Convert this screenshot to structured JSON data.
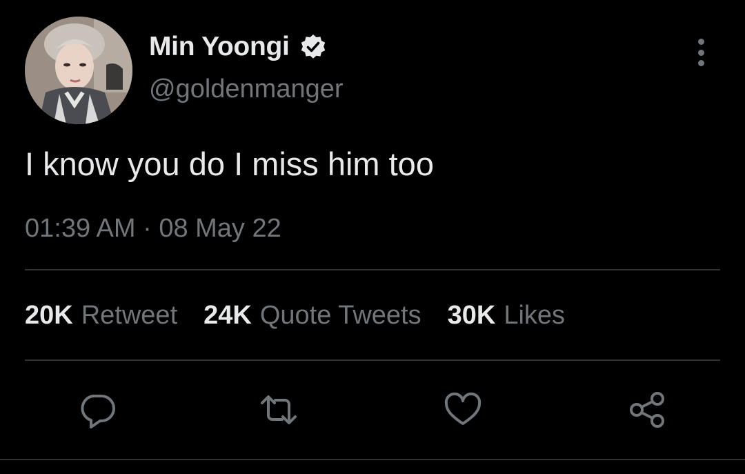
{
  "author": {
    "display_name": "Min Yoongi",
    "handle": "@goldenmanger",
    "verified": true,
    "verified_badge_icon": "verified-check-icon",
    "avatar_icon": "profile-photo"
  },
  "menu": {
    "more_icon": "more-vertical-icon"
  },
  "tweet": {
    "text": "I know you do I miss him too",
    "timestamp": "01:39 AM · 08 May 22"
  },
  "stats": [
    {
      "count": "20K",
      "label": "Retweet"
    },
    {
      "count": "24K",
      "label": "Quote Tweets"
    },
    {
      "count": "30K",
      "label": "Likes"
    }
  ],
  "actions": [
    {
      "icon": "reply-icon"
    },
    {
      "icon": "retweet-icon"
    },
    {
      "icon": "like-heart-icon"
    },
    {
      "icon": "share-icon"
    }
  ],
  "colors": {
    "background": "#000000",
    "primary_text": "#e7e9ea",
    "secondary_text": "#71767b",
    "divider": "#2f3336"
  }
}
